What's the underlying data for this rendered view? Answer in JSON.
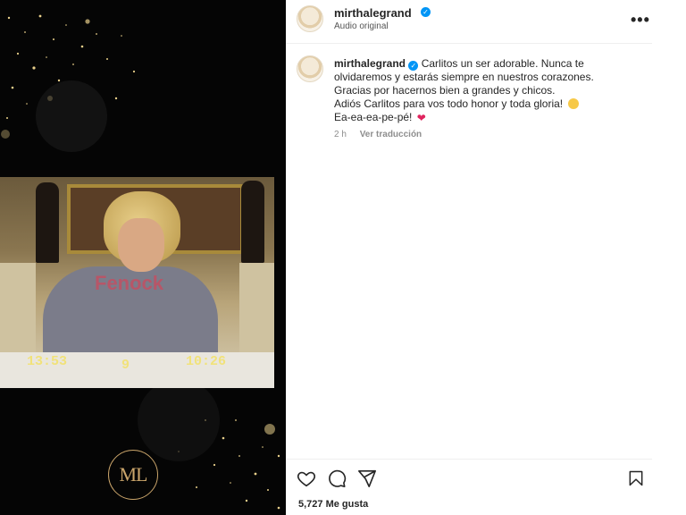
{
  "post": {
    "username": "mirthalegrand",
    "audio": "Audio original",
    "more": "•••"
  },
  "caption": {
    "username": "mirthalegrand",
    "line1": "Carlitos un ser adorable. Nunca te olvidaremos y estarás siempre en nuestros corazones. Gracias por hacernos bien a grandes y chicos.",
    "line2": "Adiós Carlitos para vos todo honor y toda gloria!",
    "line3": "Ea-ea-ea-pe-pé!",
    "time": "2 h",
    "translate": "Ver traducción"
  },
  "video": {
    "watermark": "Fenock",
    "timestamp_left": "13:53",
    "timestamp_mid": "9",
    "timestamp_right": "10:26"
  },
  "logo": {
    "text": "ML",
    "color": "#c9a46a"
  },
  "actions": {
    "icons": [
      "heart-icon",
      "comment-icon",
      "share-icon",
      "bookmark-icon"
    ]
  },
  "likes": "5,727 Me gusta",
  "colors": {
    "verified": "#0095f6",
    "text": "#262626",
    "muted": "#8e8e8e",
    "media_bg": "#050505"
  }
}
